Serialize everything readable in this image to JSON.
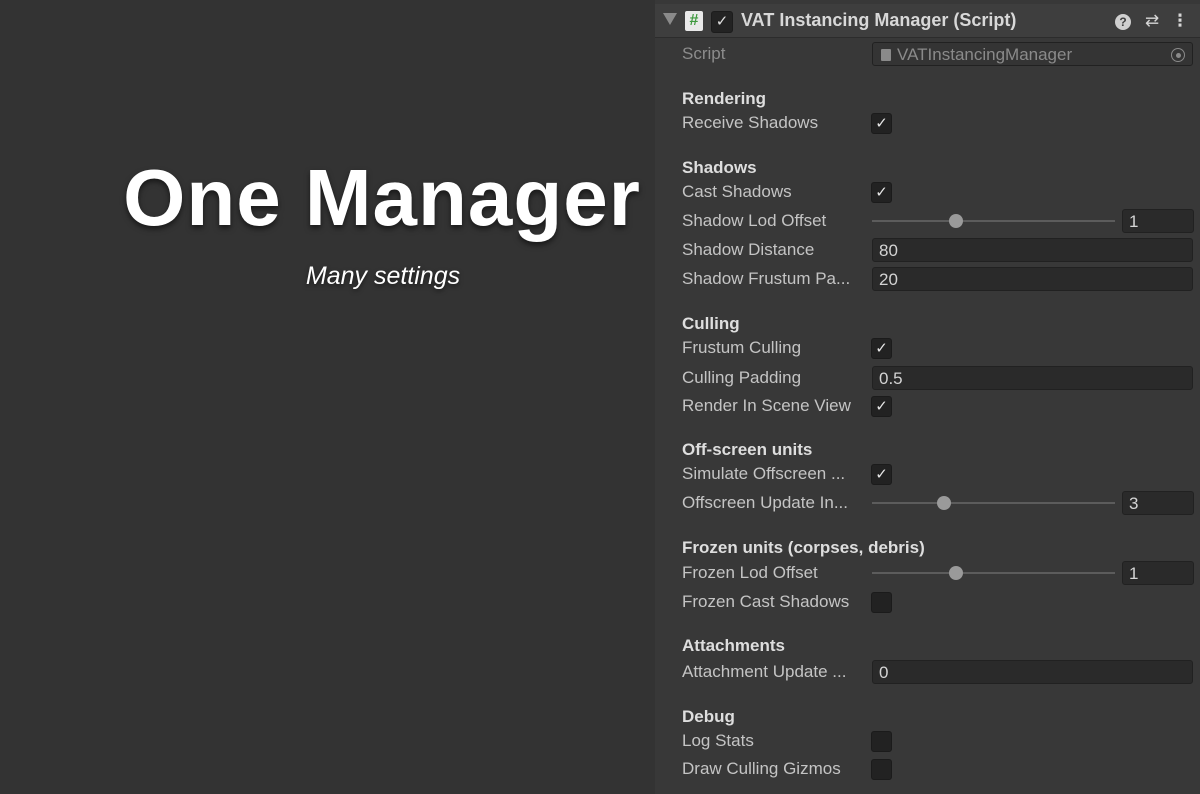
{
  "hero": {
    "title": "One Manager",
    "subtitle": "Many settings"
  },
  "component": {
    "title": "VAT Instancing Manager (Script)",
    "enabled": true,
    "icons": [
      "foldout-arrow",
      "csharp-script-icon",
      "help-icon",
      "presets-icon",
      "context-menu-icon"
    ]
  },
  "script_field": {
    "label": "Script",
    "value": "VATInstancingManager"
  },
  "sections": {
    "rendering": {
      "title": "Rendering",
      "receive_shadows": {
        "label": "Receive Shadows",
        "checked": true
      }
    },
    "shadows": {
      "title": "Shadows",
      "cast_shadows": {
        "label": "Cast Shadows",
        "checked": true
      },
      "shadow_lod_offset": {
        "label": "Shadow Lod Offset",
        "value": "1",
        "slider": 0.35
      },
      "shadow_distance": {
        "label": "Shadow Distance",
        "value": "80"
      },
      "shadow_frustum_padding": {
        "label": "Shadow Frustum Pa...",
        "value": "20"
      }
    },
    "culling": {
      "title": "Culling",
      "frustum_culling": {
        "label": "Frustum Culling",
        "checked": true
      },
      "culling_padding": {
        "label": "Culling Padding",
        "value": "0.5"
      },
      "render_in_scene_view": {
        "label": "Render In Scene View",
        "checked": true
      }
    },
    "offscreen": {
      "title": "Off-screen units",
      "simulate_offscreen": {
        "label": "Simulate Offscreen ...",
        "checked": true
      },
      "offscreen_update_interval": {
        "label": "Offscreen Update In...",
        "value": "3",
        "slider": 0.3
      }
    },
    "frozen": {
      "title": "Frozen units (corpses, debris)",
      "frozen_lod_offset": {
        "label": "Frozen Lod Offset",
        "value": "1",
        "slider": 0.35
      },
      "frozen_cast_shadows": {
        "label": "Frozen Cast Shadows",
        "checked": false
      }
    },
    "attachments": {
      "title": "Attachments",
      "attachment_update": {
        "label": "Attachment Update ...",
        "value": "0"
      }
    },
    "debug": {
      "title": "Debug",
      "log_stats": {
        "label": "Log Stats",
        "checked": false
      },
      "draw_culling_gizmos": {
        "label": "Draw Culling Gizmos",
        "checked": false
      }
    }
  }
}
